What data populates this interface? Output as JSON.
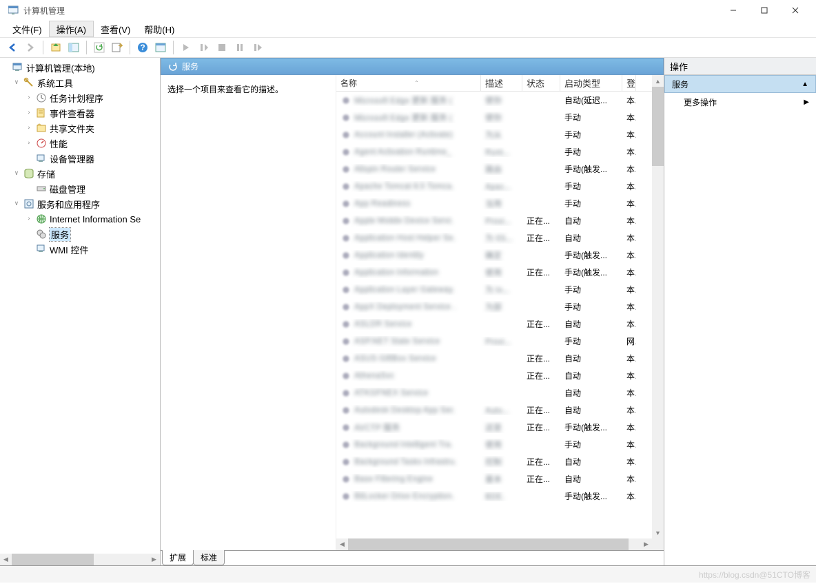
{
  "window": {
    "title": "计算机管理"
  },
  "menu": {
    "file": "文件(F)",
    "action": "操作(A)",
    "view": "查看(V)",
    "help": "帮助(H)"
  },
  "tree": {
    "root": "计算机管理(本地)",
    "system_tools": "系统工具",
    "task_scheduler": "任务计划程序",
    "event_viewer": "事件查看器",
    "shared_folders": "共享文件夹",
    "performance": "性能",
    "device_manager": "设备管理器",
    "storage": "存储",
    "disk_management": "磁盘管理",
    "services_apps": "服务和应用程序",
    "iis": "Internet Information Se",
    "services": "服务",
    "wmi": "WMI 控件"
  },
  "middle": {
    "header": "服务",
    "desc_prompt": "选择一个项目来查看它的描述。",
    "columns": {
      "name": "名称",
      "description": "描述",
      "status": "状态",
      "startup": "启动类型",
      "logon": "登"
    },
    "tabs": {
      "extended": "扩展",
      "standard": "标准"
    }
  },
  "services": [
    {
      "name": "Microsoft Edge 更新 服务 (",
      "desc": "使你",
      "status": "",
      "startup": "自动(延迟...",
      "logon": "本"
    },
    {
      "name": "Microsoft Edge 更新 服务 (",
      "desc": "使你",
      "status": "",
      "startup": "手动",
      "logon": "本"
    },
    {
      "name": "Account Installer (Activate)",
      "desc": "为从",
      "status": "",
      "startup": "手动",
      "logon": "本"
    },
    {
      "name": "Agent Activation Runtime_",
      "desc": "Runt...",
      "status": "",
      "startup": "手动",
      "logon": "本"
    },
    {
      "name": "Allspin Router Service",
      "desc": "路由",
      "status": "",
      "startup": "手动(触发...",
      "logon": "本"
    },
    {
      "name": "Apache Tomcat 8.5 Tomca.",
      "desc": "Apac...",
      "status": "",
      "startup": "手动",
      "logon": "本"
    },
    {
      "name": "App Readiness",
      "desc": "当用",
      "status": "",
      "startup": "手动",
      "logon": "本"
    },
    {
      "name": "Apple Mobile Device Servi.",
      "desc": "Provi...",
      "status": "正在...",
      "startup": "自动",
      "logon": "本"
    },
    {
      "name": "Application Host Helper Se.",
      "desc": "为 IIS...",
      "status": "正在...",
      "startup": "自动",
      "logon": "本"
    },
    {
      "name": "Application Identity",
      "desc": "确定",
      "status": "",
      "startup": "手动(触发...",
      "logon": "本"
    },
    {
      "name": "Application Information",
      "desc": "使用",
      "status": "正在...",
      "startup": "手动(触发...",
      "logon": "本"
    },
    {
      "name": "Application Layer Gateway.",
      "desc": "为 In...",
      "status": "",
      "startup": "手动",
      "logon": "本"
    },
    {
      "name": "AppX Deployment Service .",
      "desc": "为部",
      "status": "",
      "startup": "手动",
      "logon": "本"
    },
    {
      "name": "ASLDR Service",
      "desc": "",
      "status": "正在...",
      "startup": "自动",
      "logon": "本"
    },
    {
      "name": "ASP.NET State Service",
      "desc": "Provi...",
      "status": "",
      "startup": "手动",
      "logon": "网"
    },
    {
      "name": "ASUS GiftBox Service",
      "desc": "",
      "status": "正在...",
      "startup": "自动",
      "logon": "本"
    },
    {
      "name": "AthenaSvc",
      "desc": "",
      "status": "正在...",
      "startup": "自动",
      "logon": "本"
    },
    {
      "name": "ATKGFNEX Service",
      "desc": "",
      "status": "",
      "startup": "自动",
      "logon": "本"
    },
    {
      "name": "Autodesk Desktop App Ser.",
      "desc": "Auto...",
      "status": "正在...",
      "startup": "自动",
      "logon": "本"
    },
    {
      "name": "AVCTP 服务",
      "desc": "这是",
      "status": "正在...",
      "startup": "手动(触发...",
      "logon": "本"
    },
    {
      "name": "Background Intelligent Tra.",
      "desc": "使用",
      "status": "",
      "startup": "手动",
      "logon": "本"
    },
    {
      "name": "Background Tasks Infrastru.",
      "desc": "控制",
      "status": "正在...",
      "startup": "自动",
      "logon": "本"
    },
    {
      "name": "Base Filtering Engine",
      "desc": "基本",
      "status": "正在...",
      "startup": "自动",
      "logon": "本"
    },
    {
      "name": "BitLocker Drive Encryption.",
      "desc": "BDE.",
      "status": "",
      "startup": "手动(触发...",
      "logon": "本"
    }
  ],
  "actions": {
    "header": "操作",
    "services": "服务",
    "more": "更多操作"
  },
  "watermark": "https://blog.csdn@51CTO博客"
}
